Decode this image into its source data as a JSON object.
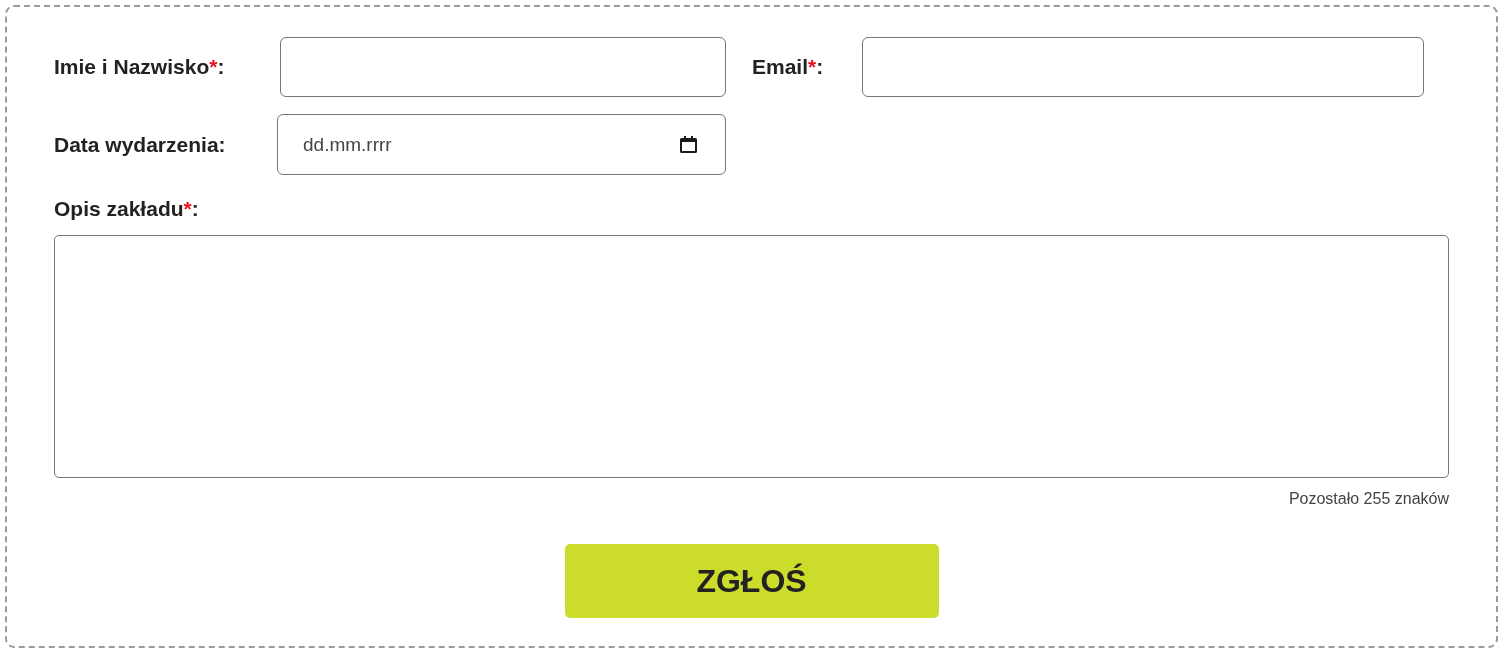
{
  "fields": [
    {
      "kind": "text",
      "label": "Imie i Nazwisko",
      "required_mark": "*",
      "suffix": ":"
    },
    {
      "kind": "email",
      "label": "Email",
      "required_mark": "*",
      "suffix": ":"
    },
    {
      "kind": "date",
      "label": "Data wydarzenia",
      "suffix": ":",
      "placeholder": "dd.mm.rrrr"
    },
    {
      "kind": "textarea",
      "label": "Opis zakładu",
      "required_mark": "*",
      "suffix": ":"
    }
  ],
  "counter": "Pozostało 255 znaków",
  "submit_button": "ZGŁOŚ"
}
